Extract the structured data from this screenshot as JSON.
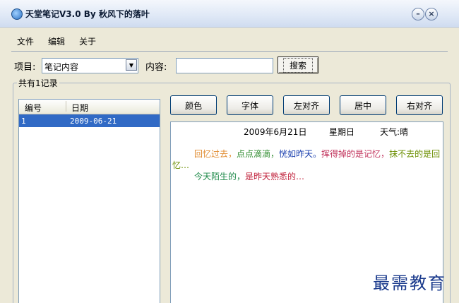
{
  "window": {
    "title": "天堂笔记V3.0   By 秋风下的落叶",
    "minimize_glyph": "–",
    "close_glyph": "×"
  },
  "menu": [
    "文件",
    "编辑",
    "关于"
  ],
  "search": {
    "project_label": "项目:",
    "project_value": "笔记内容",
    "content_label": "内容:",
    "content_value": "",
    "search_button": "搜索"
  },
  "group": {
    "title": "共有1记录"
  },
  "list": {
    "columns": [
      "编号",
      "日期"
    ],
    "rows": [
      {
        "id": "1",
        "date": "2009-06-21"
      }
    ]
  },
  "toolbar": [
    "颜色",
    "字体",
    "左对齐",
    "居中",
    "右对齐"
  ],
  "note": {
    "date": "2009年6月21日",
    "weekday": "星期日",
    "weather": "天气:晴",
    "segments_line1": [
      {
        "text": "回忆过去，",
        "color": "#e08a2e"
      },
      {
        "text": "点点滴滴，",
        "color": "#2e8b2e"
      },
      {
        "text": "恍如昨天。",
        "color": "#1a3fae"
      },
      {
        "text": "挥得掉的是记忆，",
        "color": "#c0305a"
      },
      {
        "text": "抹不去的是回",
        "color": "#6b8e00"
      }
    ],
    "line2": {
      "text": "忆…",
      "color": "#6b8e00"
    },
    "segments_line3": [
      {
        "text": "今天陌生的，",
        "color": "#1f8a4a"
      },
      {
        "text": "是昨天熟悉的…",
        "color": "#c0203a"
      }
    ]
  },
  "watermark": "最需教育"
}
